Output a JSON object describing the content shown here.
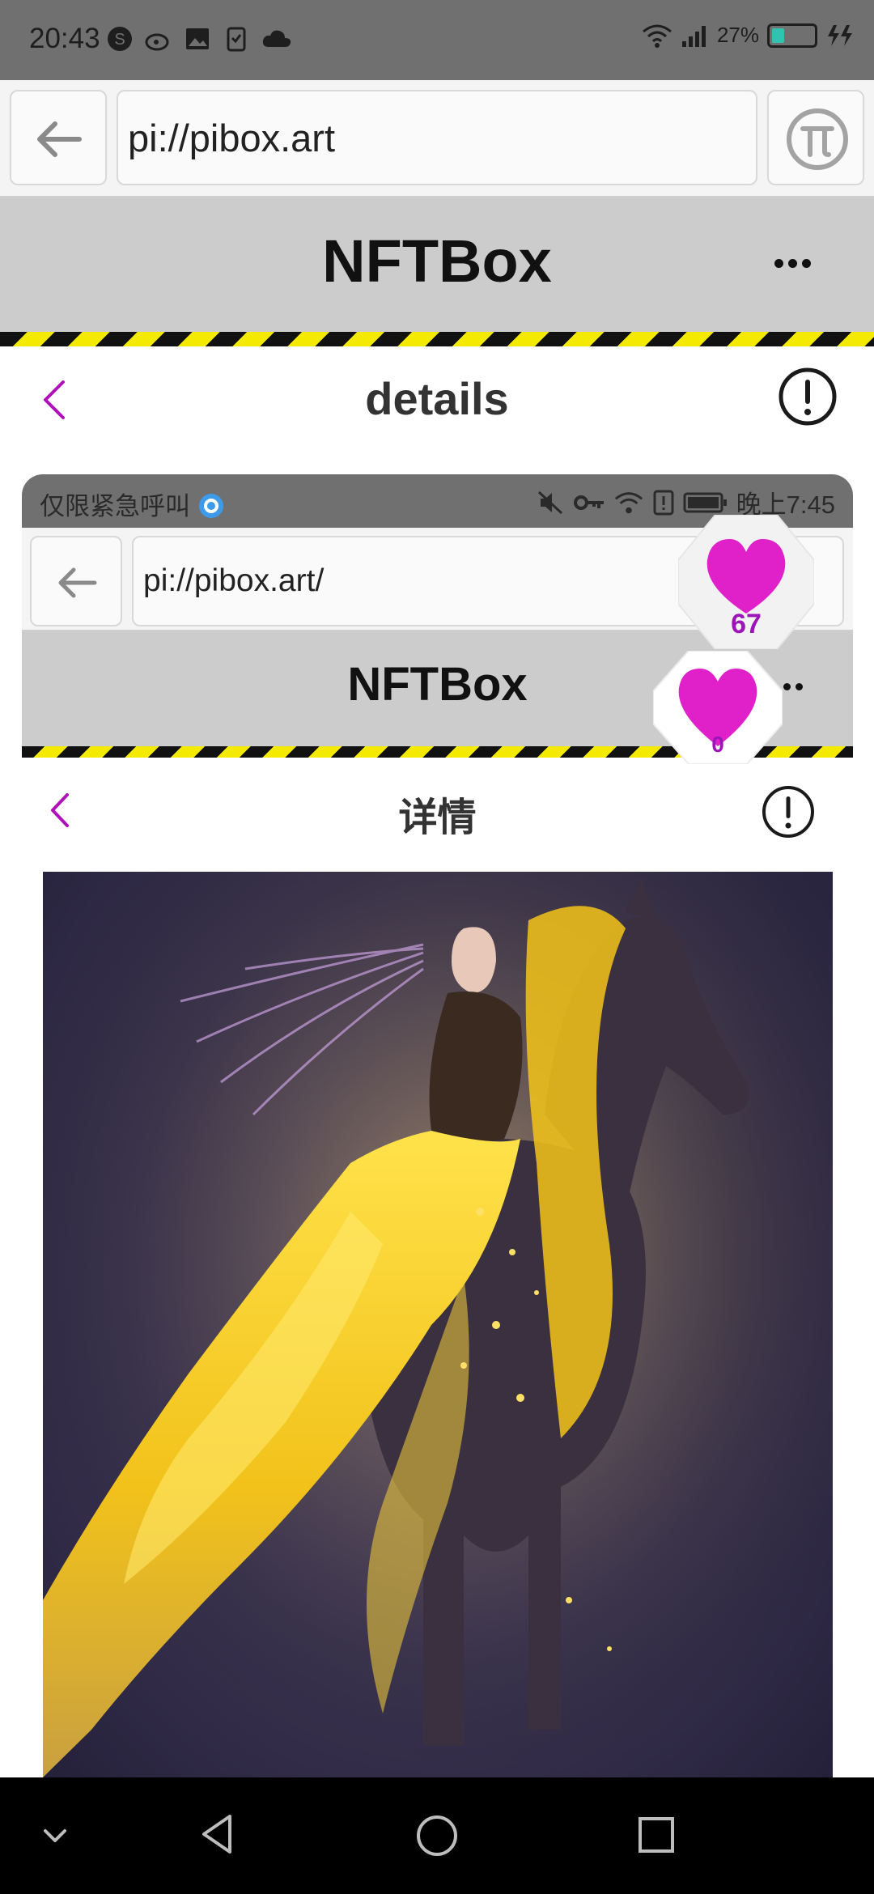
{
  "status_bar": {
    "time": "20:43",
    "battery": "27%"
  },
  "browser": {
    "url": "pi://pibox.art"
  },
  "app": {
    "title": "NFTBox"
  },
  "details_bar": {
    "title": "details"
  },
  "like_badge": {
    "count": "67"
  },
  "embedded": {
    "status_bar": {
      "carrier": "仅限紧急呼叫",
      "time": "晚上7:45"
    },
    "browser": {
      "url": "pi://pibox.art/"
    },
    "app": {
      "title": "NFTBox"
    },
    "details_bar": {
      "title": "详情"
    },
    "like_badge": {
      "count": "0"
    }
  },
  "colors": {
    "accent": "#b010b8",
    "heart": "#e020c8",
    "header_bg": "#cccccc",
    "hazard_yellow": "#f4ea00"
  }
}
